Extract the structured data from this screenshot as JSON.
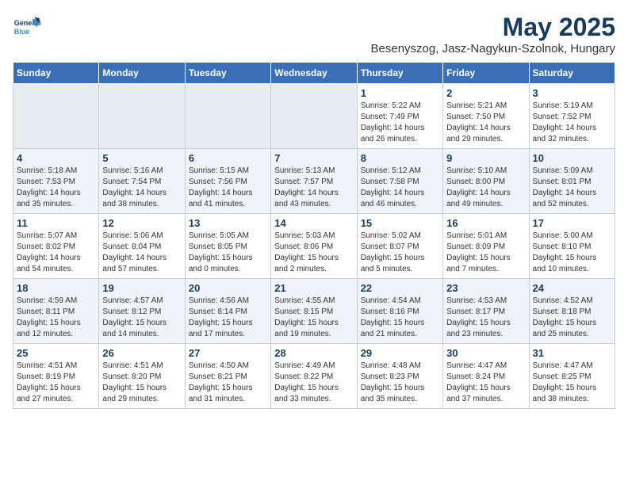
{
  "logo": {
    "line1": "General",
    "line2": "Blue"
  },
  "title": "May 2025",
  "location": "Besenyszog, Jasz-Nagykun-Szolnok, Hungary",
  "headers": [
    "Sunday",
    "Monday",
    "Tuesday",
    "Wednesday",
    "Thursday",
    "Friday",
    "Saturday"
  ],
  "weeks": [
    [
      {
        "day": "",
        "info": ""
      },
      {
        "day": "",
        "info": ""
      },
      {
        "day": "",
        "info": ""
      },
      {
        "day": "",
        "info": ""
      },
      {
        "day": "1",
        "info": "Sunrise: 5:22 AM\nSunset: 7:49 PM\nDaylight: 14 hours\nand 26 minutes."
      },
      {
        "day": "2",
        "info": "Sunrise: 5:21 AM\nSunset: 7:50 PM\nDaylight: 14 hours\nand 29 minutes."
      },
      {
        "day": "3",
        "info": "Sunrise: 5:19 AM\nSunset: 7:52 PM\nDaylight: 14 hours\nand 32 minutes."
      }
    ],
    [
      {
        "day": "4",
        "info": "Sunrise: 5:18 AM\nSunset: 7:53 PM\nDaylight: 14 hours\nand 35 minutes."
      },
      {
        "day": "5",
        "info": "Sunrise: 5:16 AM\nSunset: 7:54 PM\nDaylight: 14 hours\nand 38 minutes."
      },
      {
        "day": "6",
        "info": "Sunrise: 5:15 AM\nSunset: 7:56 PM\nDaylight: 14 hours\nand 41 minutes."
      },
      {
        "day": "7",
        "info": "Sunrise: 5:13 AM\nSunset: 7:57 PM\nDaylight: 14 hours\nand 43 minutes."
      },
      {
        "day": "8",
        "info": "Sunrise: 5:12 AM\nSunset: 7:58 PM\nDaylight: 14 hours\nand 46 minutes."
      },
      {
        "day": "9",
        "info": "Sunrise: 5:10 AM\nSunset: 8:00 PM\nDaylight: 14 hours\nand 49 minutes."
      },
      {
        "day": "10",
        "info": "Sunrise: 5:09 AM\nSunset: 8:01 PM\nDaylight: 14 hours\nand 52 minutes."
      }
    ],
    [
      {
        "day": "11",
        "info": "Sunrise: 5:07 AM\nSunset: 8:02 PM\nDaylight: 14 hours\nand 54 minutes."
      },
      {
        "day": "12",
        "info": "Sunrise: 5:06 AM\nSunset: 8:04 PM\nDaylight: 14 hours\nand 57 minutes."
      },
      {
        "day": "13",
        "info": "Sunrise: 5:05 AM\nSunset: 8:05 PM\nDaylight: 15 hours\nand 0 minutes."
      },
      {
        "day": "14",
        "info": "Sunrise: 5:03 AM\nSunset: 8:06 PM\nDaylight: 15 hours\nand 2 minutes."
      },
      {
        "day": "15",
        "info": "Sunrise: 5:02 AM\nSunset: 8:07 PM\nDaylight: 15 hours\nand 5 minutes."
      },
      {
        "day": "16",
        "info": "Sunrise: 5:01 AM\nSunset: 8:09 PM\nDaylight: 15 hours\nand 7 minutes."
      },
      {
        "day": "17",
        "info": "Sunrise: 5:00 AM\nSunset: 8:10 PM\nDaylight: 15 hours\nand 10 minutes."
      }
    ],
    [
      {
        "day": "18",
        "info": "Sunrise: 4:59 AM\nSunset: 8:11 PM\nDaylight: 15 hours\nand 12 minutes."
      },
      {
        "day": "19",
        "info": "Sunrise: 4:57 AM\nSunset: 8:12 PM\nDaylight: 15 hours\nand 14 minutes."
      },
      {
        "day": "20",
        "info": "Sunrise: 4:56 AM\nSunset: 8:14 PM\nDaylight: 15 hours\nand 17 minutes."
      },
      {
        "day": "21",
        "info": "Sunrise: 4:55 AM\nSunset: 8:15 PM\nDaylight: 15 hours\nand 19 minutes."
      },
      {
        "day": "22",
        "info": "Sunrise: 4:54 AM\nSunset: 8:16 PM\nDaylight: 15 hours\nand 21 minutes."
      },
      {
        "day": "23",
        "info": "Sunrise: 4:53 AM\nSunset: 8:17 PM\nDaylight: 15 hours\nand 23 minutes."
      },
      {
        "day": "24",
        "info": "Sunrise: 4:52 AM\nSunset: 8:18 PM\nDaylight: 15 hours\nand 25 minutes."
      }
    ],
    [
      {
        "day": "25",
        "info": "Sunrise: 4:51 AM\nSunset: 8:19 PM\nDaylight: 15 hours\nand 27 minutes."
      },
      {
        "day": "26",
        "info": "Sunrise: 4:51 AM\nSunset: 8:20 PM\nDaylight: 15 hours\nand 29 minutes."
      },
      {
        "day": "27",
        "info": "Sunrise: 4:50 AM\nSunset: 8:21 PM\nDaylight: 15 hours\nand 31 minutes."
      },
      {
        "day": "28",
        "info": "Sunrise: 4:49 AM\nSunset: 8:22 PM\nDaylight: 15 hours\nand 33 minutes."
      },
      {
        "day": "29",
        "info": "Sunrise: 4:48 AM\nSunset: 8:23 PM\nDaylight: 15 hours\nand 35 minutes."
      },
      {
        "day": "30",
        "info": "Sunrise: 4:47 AM\nSunset: 8:24 PM\nDaylight: 15 hours\nand 37 minutes."
      },
      {
        "day": "31",
        "info": "Sunrise: 4:47 AM\nSunset: 8:25 PM\nDaylight: 15 hours\nand 38 minutes."
      }
    ]
  ]
}
